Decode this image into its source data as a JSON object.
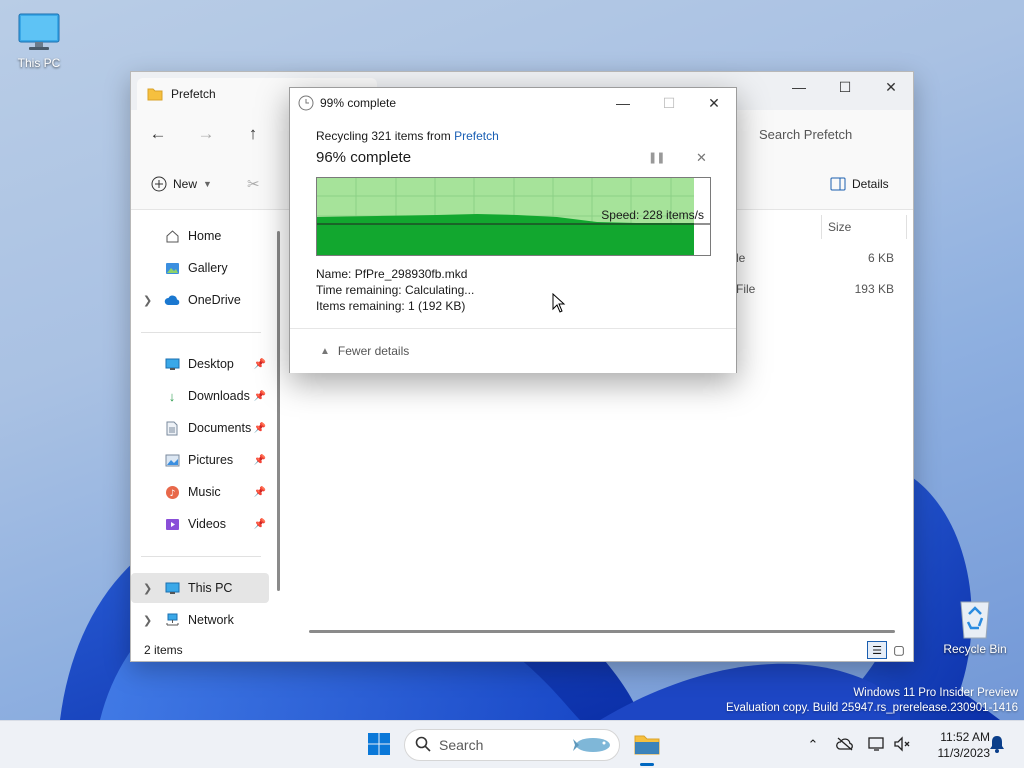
{
  "desktop": {
    "icons": [
      {
        "label": "This PC",
        "icon": "monitor-icon"
      },
      {
        "label": "Recycle Bin",
        "icon": "recycle-bin-icon"
      }
    ],
    "watermark": {
      "line1": "Windows 11 Pro Insider Preview",
      "line2": "Evaluation copy. Build 25947.rs_prerelease.230901-1416"
    }
  },
  "explorer": {
    "tab_title": "Prefetch",
    "search_placeholder": "Search Prefetch",
    "toolbar": {
      "new_label": "New",
      "details_label": "Details"
    },
    "sidebar": {
      "top": [
        {
          "label": "Home",
          "icon": "home-icon"
        },
        {
          "label": "Gallery",
          "icon": "gallery-icon"
        },
        {
          "label": "OneDrive",
          "icon": "cloud-icon"
        }
      ],
      "quick": [
        {
          "label": "Desktop",
          "icon": "desktop-icon"
        },
        {
          "label": "Downloads",
          "icon": "download-icon"
        },
        {
          "label": "Documents",
          "icon": "document-icon"
        },
        {
          "label": "Pictures",
          "icon": "pictures-icon"
        },
        {
          "label": "Music",
          "icon": "music-icon"
        },
        {
          "label": "Videos",
          "icon": "video-icon"
        }
      ],
      "bottom": [
        {
          "label": "This PC",
          "icon": "monitor-icon"
        },
        {
          "label": "Network",
          "icon": "network-icon"
        }
      ]
    },
    "columns": {
      "size": "Size"
    },
    "rows": [
      {
        "type_fragment": "le",
        "size": "6 KB"
      },
      {
        "type_fragment": "File",
        "size": "193 KB"
      }
    ],
    "status": "2 items"
  },
  "dialog": {
    "title": "99% complete",
    "summary_prefix": "Recycling 321 items from",
    "summary_link": "Prefetch",
    "percent_text": "96% complete",
    "speed": "Speed: 228 items/s",
    "name_label": "Name:",
    "name_value": "PfPre_298930fb.mkd",
    "time_label": "Time remaining:",
    "time_value": "Calculating...",
    "items_label": "Items remaining:",
    "items_value": "1 (192 KB)",
    "fewer_details": "Fewer details",
    "progress_fraction": 0.96
  },
  "taskbar": {
    "search_placeholder": "Search",
    "time": "11:52 AM",
    "date": "11/3/2023"
  },
  "colors": {
    "progress_fill": "#12a72f",
    "progress_bg": "#a6e39a",
    "link": "#1a5fb4",
    "accent": "#0067c0"
  }
}
